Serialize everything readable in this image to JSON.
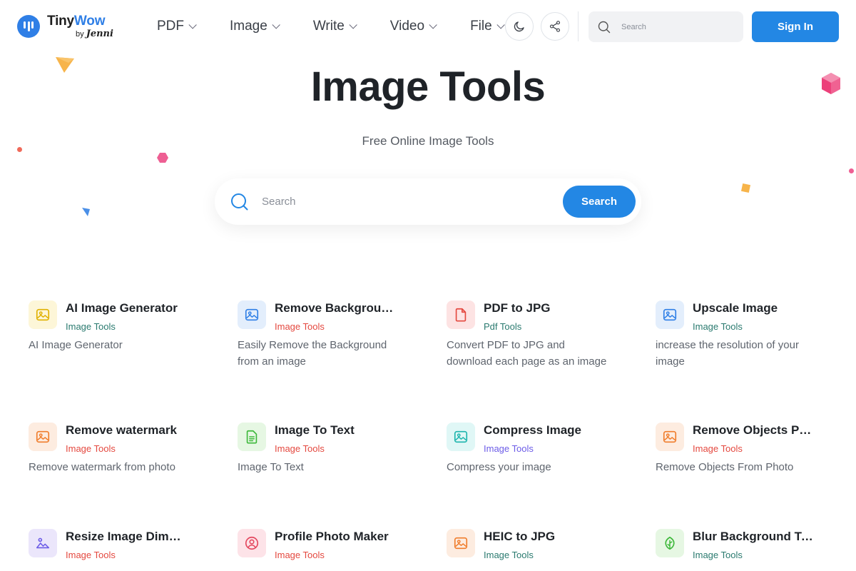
{
  "header": {
    "logo": {
      "title_a": "Tiny",
      "title_b": "Wow",
      "by": "by",
      "brand": "Jenni"
    },
    "nav": [
      {
        "label": "PDF"
      },
      {
        "label": "Image"
      },
      {
        "label": "Write"
      },
      {
        "label": "Video"
      },
      {
        "label": "File"
      }
    ],
    "theme_icon": "moon-icon",
    "share_icon": "share-icon",
    "search_placeholder": "Search",
    "signin_label": "Sign In"
  },
  "hero": {
    "title": "Image Tools",
    "subtitle": "Free Online Image Tools",
    "search_placeholder": "Search",
    "search_button": "Search"
  },
  "colors": {
    "accent": "#2387e4",
    "cat_teal": "#2a7a6f",
    "cat_red": "#e4483f",
    "cat_purple": "#6c5ce7"
  },
  "tools": [
    {
      "title": "AI Image Generator",
      "category": "Image Tools",
      "desc": "AI Image Generator",
      "icon": "image-icon",
      "icon_bg": "#fdf6d8",
      "icon_color": "#e0b100",
      "cat_color": "#2a7a6f"
    },
    {
      "title": "Remove Background",
      "category": "Image Tools",
      "desc": "Easily Remove the Background from an image",
      "icon": "image-icon",
      "icon_bg": "#e3eefc",
      "icon_color": "#2f7fe6",
      "cat_color": "#e4483f"
    },
    {
      "title": "PDF to JPG",
      "category": "Pdf Tools",
      "desc": "Convert PDF to JPG and download each page as an image",
      "icon": "file-icon",
      "icon_bg": "#fde3e3",
      "icon_color": "#e4483f",
      "cat_color": "#2a7a6f"
    },
    {
      "title": "Upscale Image",
      "category": "Image Tools",
      "desc": "increase the resolution of your image",
      "icon": "image-icon",
      "icon_bg": "#e3eefc",
      "icon_color": "#2f7fe6",
      "cat_color": "#2a7a6f"
    },
    {
      "title": "Remove watermark",
      "category": "Image Tools",
      "desc": "Remove watermark from photo",
      "icon": "image-icon",
      "icon_bg": "#fdece0",
      "icon_color": "#f07d2c",
      "cat_color": "#e4483f"
    },
    {
      "title": "Image To Text",
      "category": "Image Tools",
      "desc": "Image To Text",
      "icon": "document-icon",
      "icon_bg": "#e6f7e3",
      "icon_color": "#3db83a",
      "cat_color": "#e4483f"
    },
    {
      "title": "Compress Image",
      "category": "Image Tools",
      "desc": "Compress your image",
      "icon": "image-icon",
      "icon_bg": "#e0f7f6",
      "icon_color": "#1db5ad",
      "cat_color": "#6c5ce7"
    },
    {
      "title": "Remove Objects Photo",
      "category": "Image Tools",
      "desc": "Remove Objects From Photo",
      "icon": "image-icon",
      "icon_bg": "#fdece0",
      "icon_color": "#f07d2c",
      "cat_color": "#e4483f"
    },
    {
      "title": "Resize Image Dimensions",
      "category": "Image Tools",
      "desc": "",
      "icon": "landscape-icon",
      "icon_bg": "#ebe6fb",
      "icon_color": "#6c5ce7",
      "cat_color": "#e4483f"
    },
    {
      "title": "Profile Photo Maker",
      "category": "Image Tools",
      "desc": "",
      "icon": "user-circle-icon",
      "icon_bg": "#fde3e8",
      "icon_color": "#e4485f",
      "cat_color": "#e4483f"
    },
    {
      "title": "HEIC to JPG",
      "category": "Image Tools",
      "desc": "",
      "icon": "image-icon",
      "icon_bg": "#fdece0",
      "icon_color": "#f07d2c",
      "cat_color": "#2a7a6f"
    },
    {
      "title": "Blur Background Tool",
      "category": "Image Tools",
      "desc": "",
      "icon": "leaf-icon",
      "icon_bg": "#e6f7e3",
      "icon_color": "#3db83a",
      "cat_color": "#2a7a6f"
    }
  ]
}
